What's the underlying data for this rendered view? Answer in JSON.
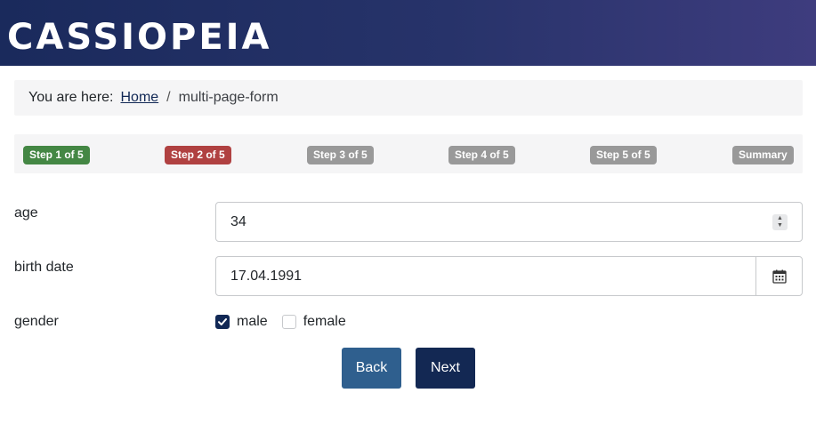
{
  "header": {
    "brand": "CASSIOPEIA"
  },
  "breadcrumb": {
    "prefix": "You are here:",
    "home": "Home",
    "separator": "/",
    "current": "multi-page-form"
  },
  "steps": [
    {
      "label": "Step 1 of 5",
      "state": "done"
    },
    {
      "label": "Step 2 of 5",
      "state": "active"
    },
    {
      "label": "Step 3 of 5",
      "state": "todo"
    },
    {
      "label": "Step 4 of 5",
      "state": "todo"
    },
    {
      "label": "Step 5 of 5",
      "state": "todo"
    },
    {
      "label": "Summary",
      "state": "todo"
    }
  ],
  "form": {
    "age": {
      "label": "age",
      "value": "34"
    },
    "birth_date": {
      "label": "birth date",
      "value": "17.04.1991",
      "icon": "calendar-icon"
    },
    "gender": {
      "label": "gender",
      "options": [
        {
          "label": "male",
          "checked": true
        },
        {
          "label": "female",
          "checked": false
        }
      ]
    }
  },
  "actions": {
    "back": "Back",
    "next": "Next"
  },
  "colors": {
    "header_start": "#1a2a5c",
    "header_end": "#3e3c7e",
    "step_done": "#448744",
    "step_active": "#b04141",
    "step_todo": "#999999",
    "primary": "#132853",
    "secondary": "#2f5f8e"
  }
}
